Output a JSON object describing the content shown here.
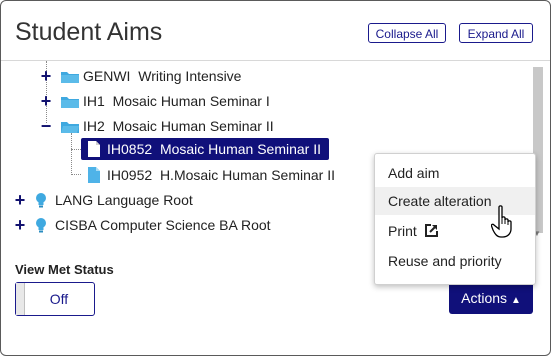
{
  "panel": {
    "title": "Student Aims",
    "collapse_all_label": "Collapse All",
    "expand_all_label": "Expand All"
  },
  "tree": {
    "items": [
      {
        "code": "GENWI",
        "name": "Writing Intensive",
        "toggle": "+"
      },
      {
        "code": "IH1",
        "name": "Mosaic Human Seminar I",
        "toggle": "+"
      },
      {
        "code": "IH2",
        "name": "Mosaic Human Seminar II",
        "toggle": "−"
      },
      {
        "code": "IH0852",
        "name": "Mosaic Human Seminar II"
      },
      {
        "code": "IH0952",
        "name": "H.Mosaic Human Seminar II"
      },
      {
        "label": "LANG Language Root",
        "toggle": "+"
      },
      {
        "label": "CISBA Computer Science BA Root",
        "toggle": "+"
      }
    ]
  },
  "actions_menu": {
    "items": [
      "Add aim",
      "Create alteration",
      "Print",
      "Reuse and priority"
    ]
  },
  "view_met_status": {
    "label": "View Met Status",
    "value": "Off"
  },
  "actions_button_label": "Actions",
  "colors": {
    "accent": "#10107a",
    "folder": "#3fa9e0",
    "doc": "#4fb3e8"
  }
}
